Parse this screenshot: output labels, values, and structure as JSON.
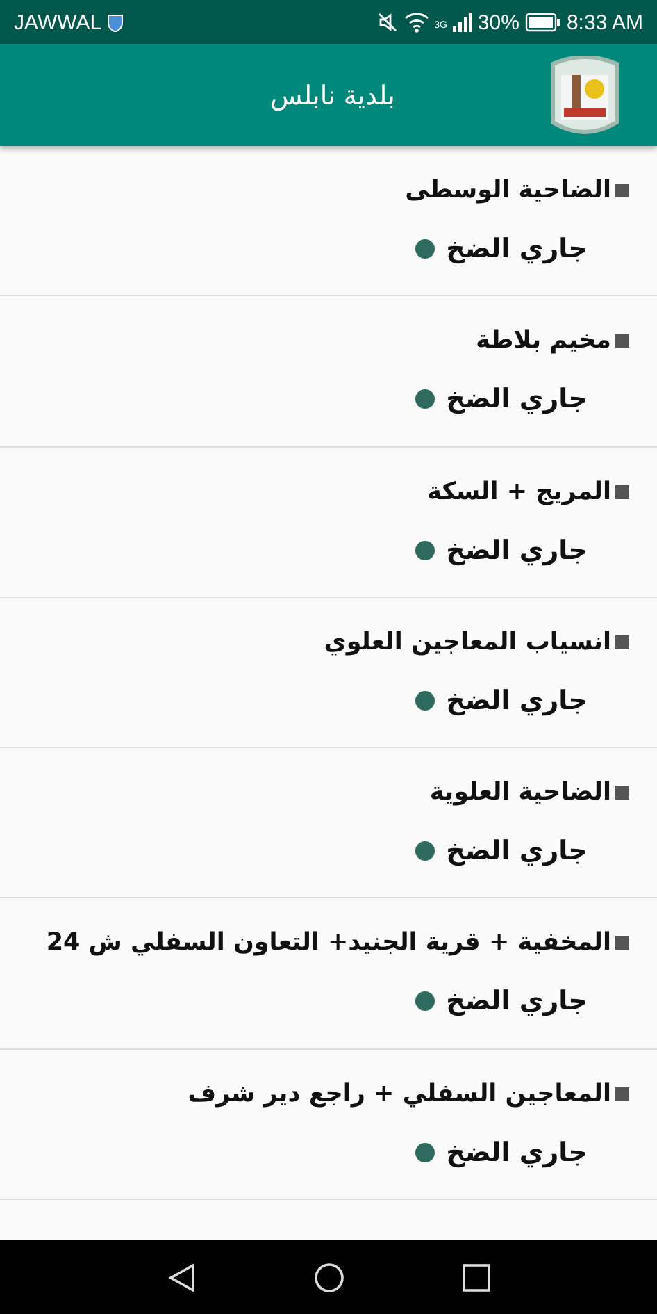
{
  "status_bar": {
    "carrier": "JAWWAL",
    "signal_label": "3G",
    "battery": "30%",
    "time": "8:33 AM"
  },
  "app_bar": {
    "title": "بلدية نابلس"
  },
  "areas": [
    {
      "name": "الضاحية الوسطى",
      "status": "جاري الضخ",
      "color": "#2e6b5e"
    },
    {
      "name": "مخيم بلاطة",
      "status": "جاري الضخ",
      "color": "#2e6b5e"
    },
    {
      "name": "المريج + السكة",
      "status": "جاري الضخ",
      "color": "#2e6b5e"
    },
    {
      "name": "انسياب المعاجين العلوي",
      "status": "جاري الضخ",
      "color": "#2e6b5e"
    },
    {
      "name": "الضاحية العلوية",
      "status": "جاري الضخ",
      "color": "#2e6b5e"
    },
    {
      "name": "المخفية + قرية الجنيد+ التعاون السفلي ش 24",
      "status": "جاري الضخ",
      "color": "#2e6b5e"
    },
    {
      "name": "المعاجين السفلي + راجع دير شرف",
      "status": "جاري الضخ",
      "color": "#2e6b5e"
    }
  ]
}
